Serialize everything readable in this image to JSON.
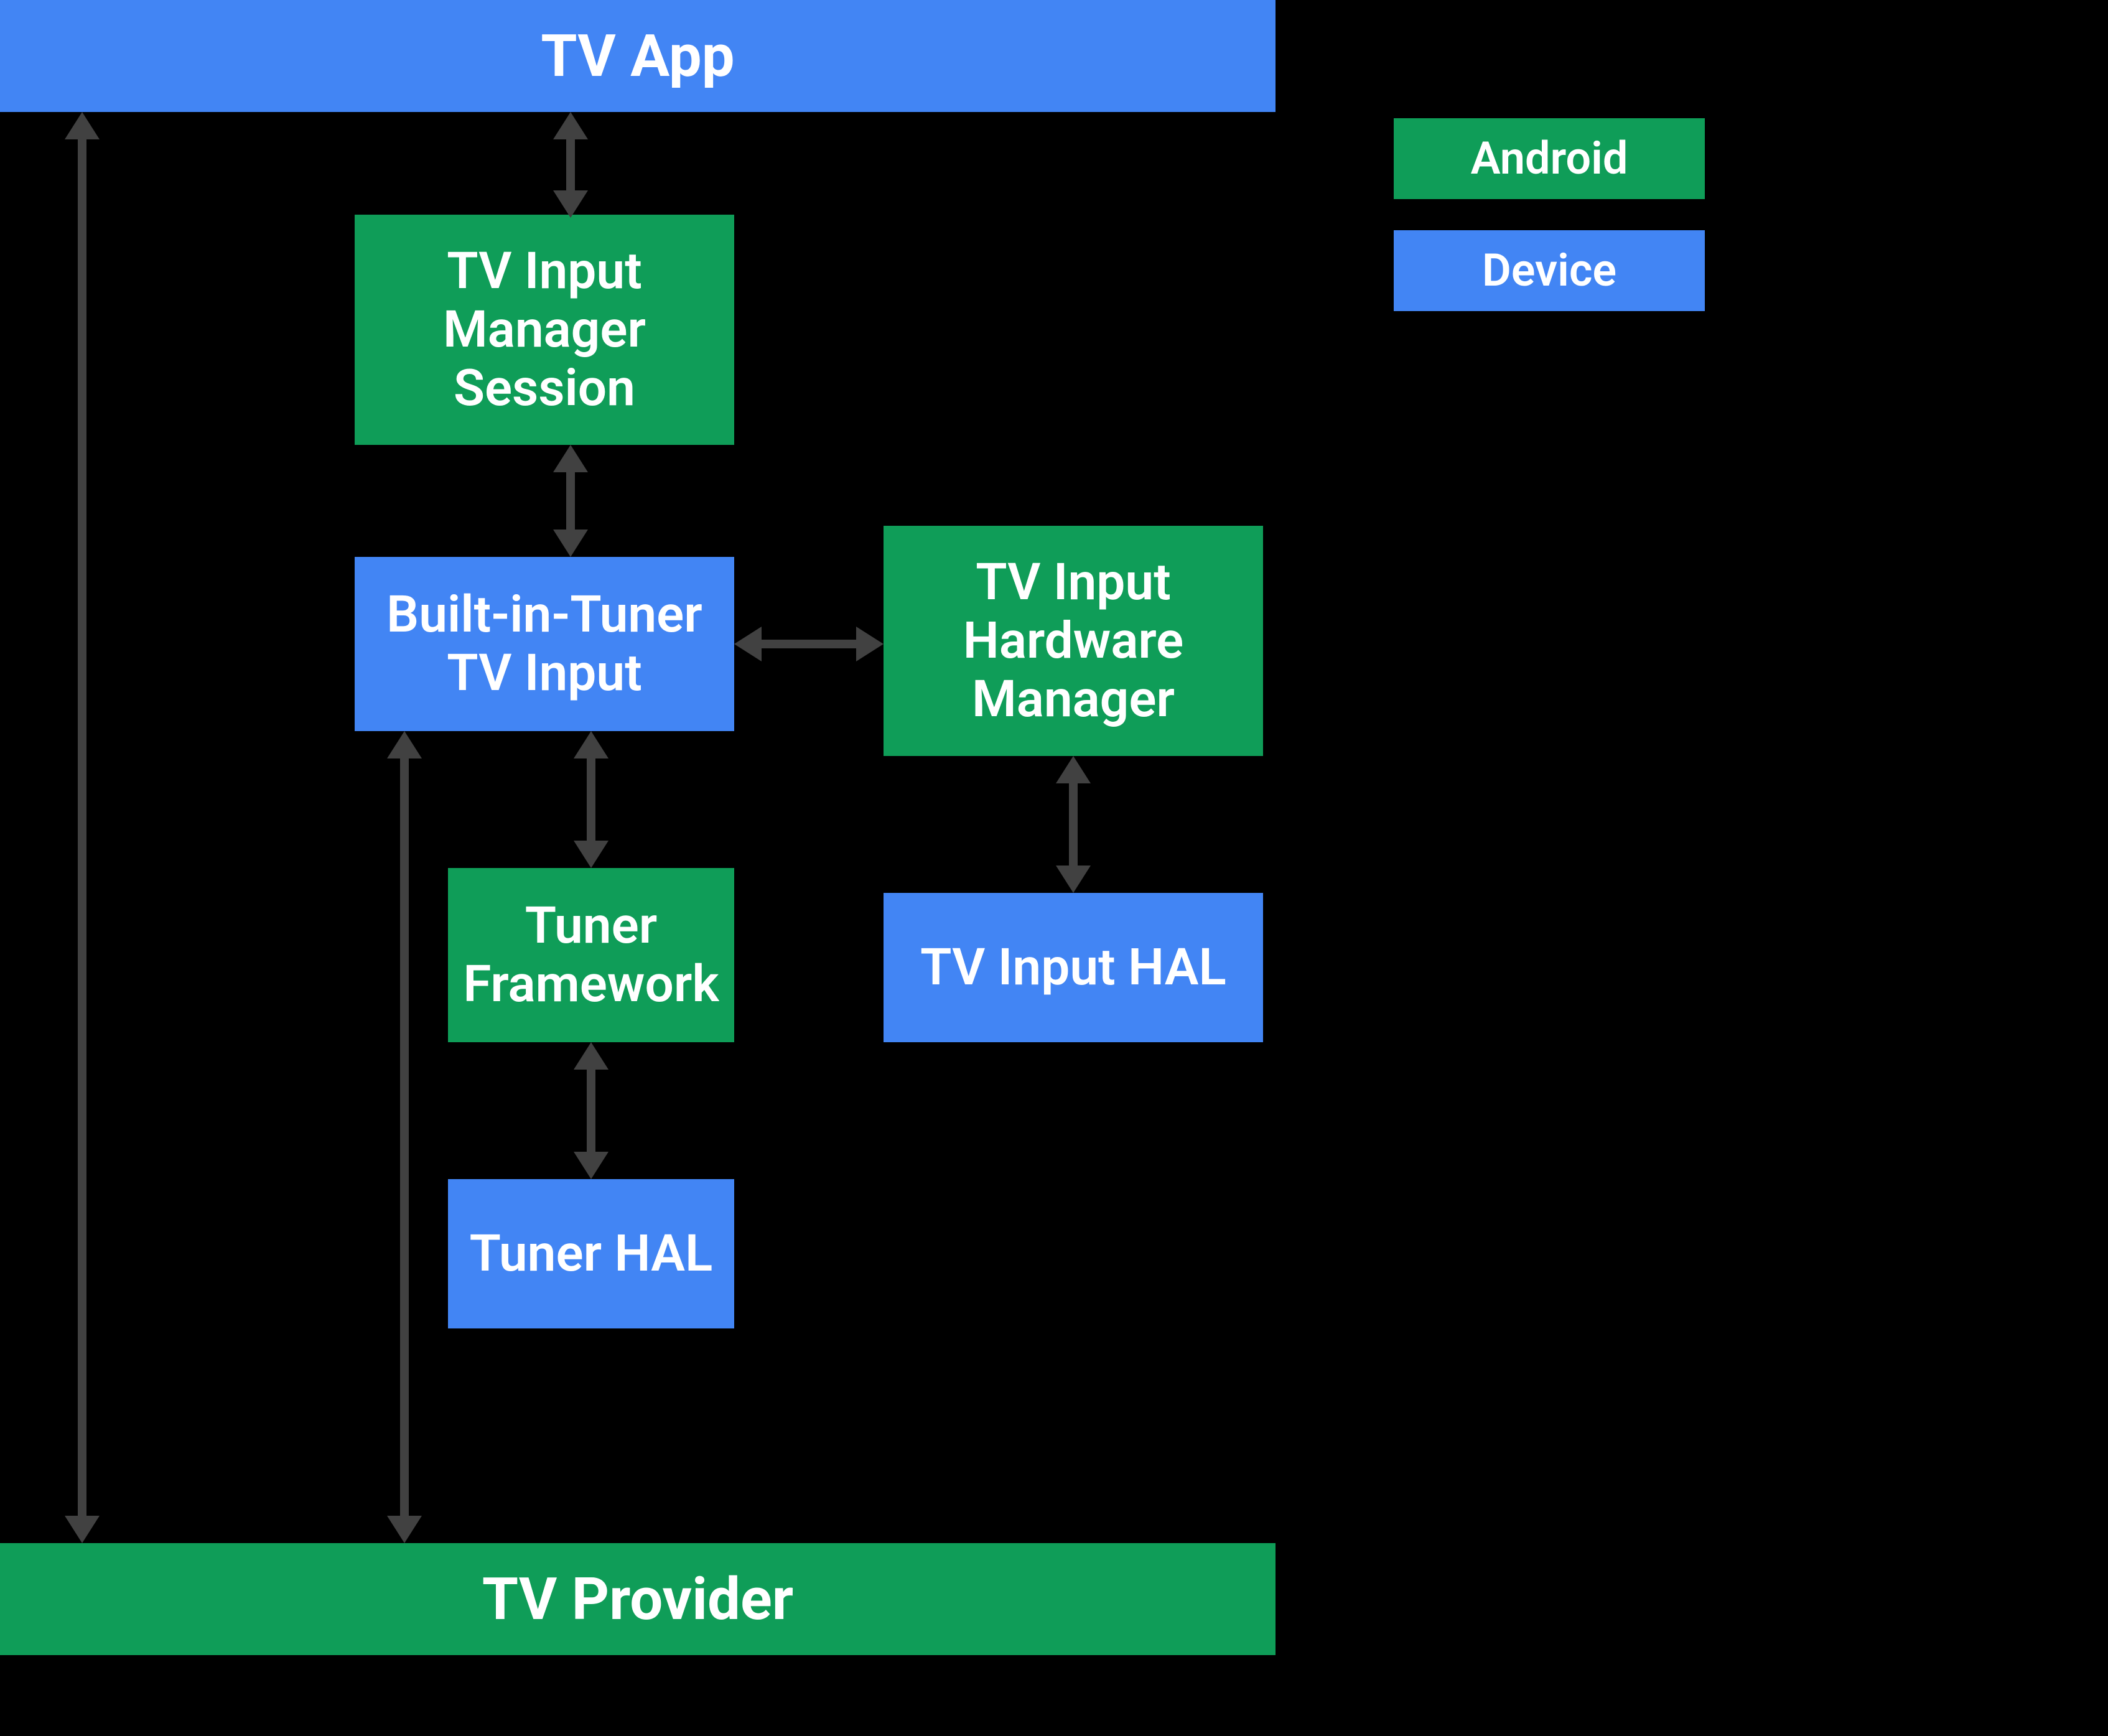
{
  "colors": {
    "android": "#0f9d58",
    "device": "#4285f4",
    "arrow": "#414141"
  },
  "legend": {
    "android": "Android",
    "device": "Device"
  },
  "nodes": {
    "tv_app": "TV App",
    "tv_input_manager_session": "TV Input\nManager\nSession",
    "built_in_tuner_tv_input": "Built-in-Tuner\nTV Input",
    "tv_input_hardware_manager": "TV Input\nHardware\nManager",
    "tuner_framework": "Tuner\nFramework",
    "tv_input_hal": "TV Input HAL",
    "tuner_hal": "Tuner HAL",
    "tv_provider": "TV Provider"
  },
  "edges": [
    "tv_app <-> tv_input_manager_session",
    "tv_input_manager_session <-> built_in_tuner_tv_input",
    "built_in_tuner_tv_input <-> tv_input_hardware_manager",
    "built_in_tuner_tv_input <-> tuner_framework",
    "tv_input_hardware_manager <-> tv_input_hal",
    "tuner_framework <-> tuner_hal",
    "tv_app <-> tv_provider",
    "built_in_tuner_tv_input <-> tv_provider"
  ]
}
